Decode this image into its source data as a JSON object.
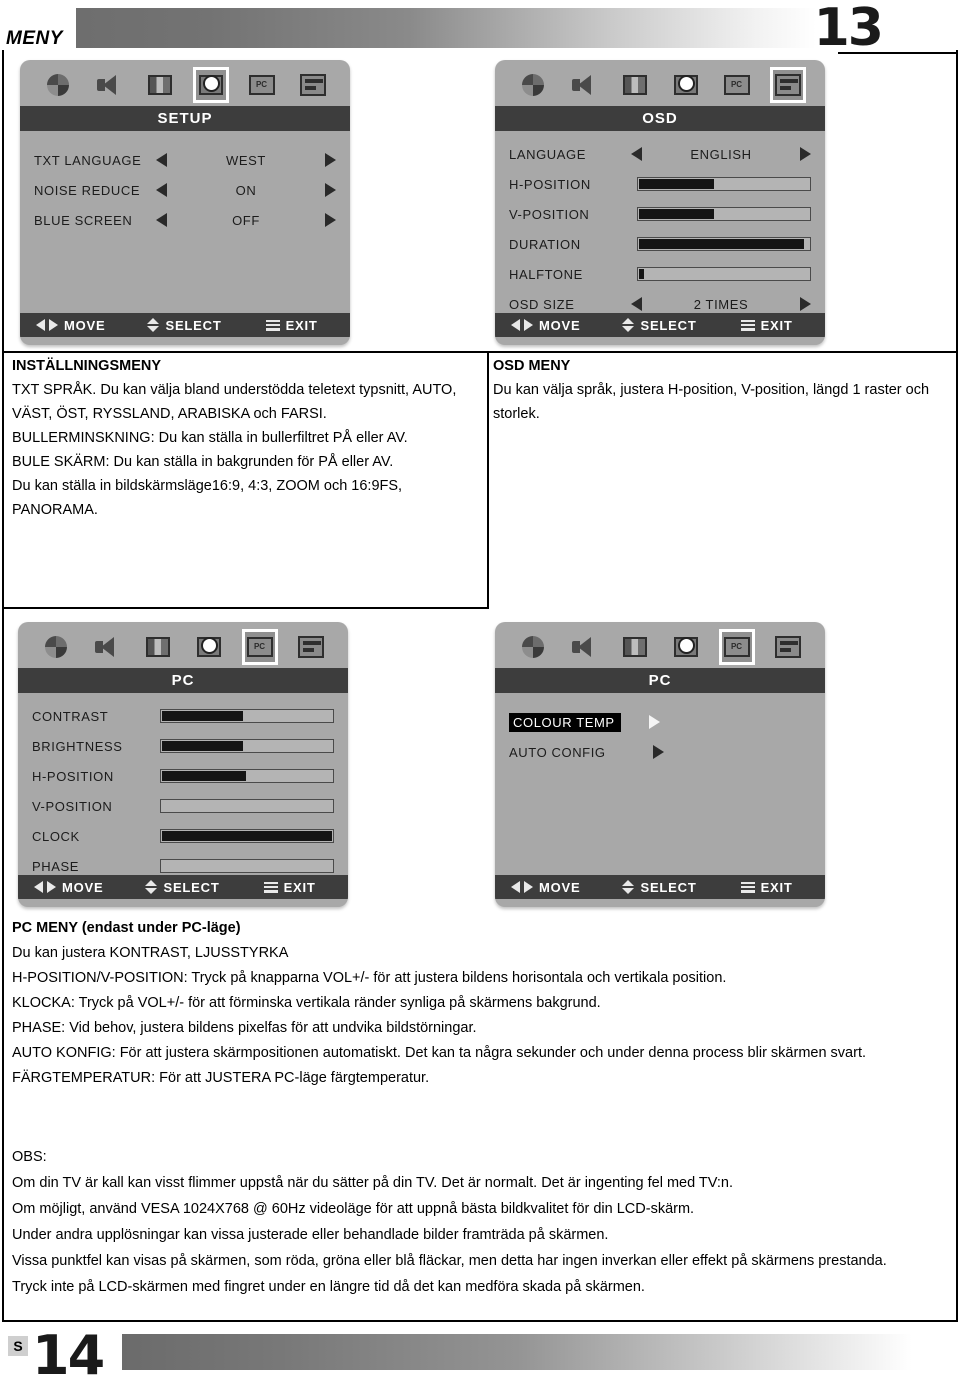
{
  "header": {
    "section_label": "MENY",
    "page_number": "13"
  },
  "footer": {
    "lang_code": "S",
    "page_number": "14"
  },
  "panels": [
    {
      "id": "setup",
      "title": "SETUP",
      "selected_icon_index": 3,
      "icons": [
        "picture-wheel-icon",
        "speaker-icon",
        "tv-screen-icon",
        "clock-setup-icon",
        "pc-icon",
        "osd-settings-icon"
      ],
      "rows": [
        {
          "type": "option",
          "label": "TXT LANGUAGE",
          "value": "WEST"
        },
        {
          "type": "option",
          "label": "NOISE  REDUCE",
          "value": "ON"
        },
        {
          "type": "option",
          "label": "BLUE SCREEN",
          "value": "OFF"
        }
      ],
      "footer": {
        "move": "MOVE",
        "select": "SELECT",
        "exit": "EXIT"
      }
    },
    {
      "id": "osd",
      "title": "OSD",
      "selected_icon_index": 5,
      "icons": [
        "picture-wheel-icon",
        "speaker-icon",
        "tv-screen-icon",
        "clock-setup-icon",
        "pc-icon",
        "osd-settings-icon"
      ],
      "rows": [
        {
          "type": "option",
          "label": "LANGUAGE",
          "value": "ENGLISH"
        },
        {
          "type": "slider",
          "label": "H-POSITION",
          "fill": 45
        },
        {
          "type": "slider",
          "label": "V-POSITION",
          "fill": 45
        },
        {
          "type": "slider",
          "label": "DURATION",
          "fill": 97
        },
        {
          "type": "slider",
          "label": "HALFTONE",
          "fill": 4
        },
        {
          "type": "option",
          "label": "OSD  SIZE",
          "value": "2  TIMES"
        }
      ],
      "footer": {
        "move": "MOVE",
        "select": "SELECT",
        "exit": "EXIT"
      }
    },
    {
      "id": "pc-main",
      "title": "PC",
      "selected_icon_index": 4,
      "icons": [
        "picture-wheel-icon",
        "speaker-icon",
        "tv-screen-icon",
        "clock-setup-icon",
        "pc-icon",
        "osd-settings-icon"
      ],
      "rows": [
        {
          "type": "slider",
          "label": "CONTRAST",
          "fill": 48
        },
        {
          "type": "slider",
          "label": "BRIGHTNESS",
          "fill": 48
        },
        {
          "type": "slider",
          "label": "H-POSITION",
          "fill": 50
        },
        {
          "type": "slider",
          "label": "V-POSITION",
          "fill": 0
        },
        {
          "type": "slider",
          "label": "CLOCK",
          "fill": 100
        },
        {
          "type": "slider",
          "label": "PHASE",
          "fill": 0
        }
      ],
      "footer": {
        "move": "MOVE",
        "select": "SELECT",
        "exit": "EXIT"
      }
    },
    {
      "id": "pc-sub",
      "title": "PC",
      "selected_icon_index": 4,
      "icons": [
        "picture-wheel-icon",
        "speaker-icon",
        "tv-screen-icon",
        "clock-setup-icon",
        "pc-icon",
        "osd-settings-icon"
      ],
      "rows": [
        {
          "type": "submenu",
          "label": "COLOUR TEMP",
          "highlighted": true
        },
        {
          "type": "submenu",
          "label": "AUTO  CONFIG",
          "highlighted": false
        }
      ],
      "footer": {
        "move": "MOVE",
        "select": "SELECT",
        "exit": "EXIT"
      }
    }
  ],
  "text": {
    "setup_menu": {
      "heading": "INSTÄLLNINGSMENY",
      "body": "TXT SPRÅK. Du kan välja bland understödda teletext typsnitt, AUTO, VÄST, ÖST, RYSSLAND, ARABISKA och FARSI.\nBULLERMINSKNING: Du kan ställa in bullerfiltret PÅ eller AV.\nBULE SKÄRM: Du kan ställa in bakgrunden för PÅ eller AV.\nDu kan ställa in bildskärmsläge16:9, 4:3, ZOOM och  16:9FS, PANORAMA."
    },
    "osd_menu": {
      "heading": "OSD MENY",
      "body": "Du kan välja språk, justera H-position, V-position, längd 1 raster och storlek."
    },
    "pc_menu": {
      "heading": "PC MENY (endast under PC-läge)",
      "lines": [
        "Du kan justera KONTRAST, LJUSSTYRKA",
        "H-POSITION/V-POSITION: Tryck på knapparna VOL+/- för att justera bildens horisontala och vertikala position.",
        "KLOCKA: Tryck på VOL+/- för att förminska vertikala ränder synliga på skärmens bakgrund.",
        "PHASE: Vid behov, justera bildens pixelfas för att undvika bildstörningar.",
        "AUTO KONFIG: För att justera skärmpositionen automatiskt. Det kan ta några sekunder och under denna process blir skärmen svart.",
        "FÄRGTEMPERATUR: För att JUSTERA PC-läge färgtemperatur."
      ]
    },
    "note": {
      "heading": "OBS:",
      "lines": [
        "Om din TV är kall kan visst flimmer uppstå när du sätter på din TV. Det är normalt. Det är ingenting fel med TV:n.",
        "Om möjligt, använd VESA 1024X768 @ 60Hz videoläge för att uppnå bästa bildkvalitet för din LCD-skärm.",
        "Under andra upplösningar kan vissa justerade eller behandlade bilder framträda på skärmen.",
        "Vissa punktfel kan visas på skärmen, som röda, gröna eller blå fläckar, men detta har ingen inverkan eller effekt på skärmens prestanda.",
        "Tryck inte på LCD-skärmen med fingret under en längre tid då det kan medföra skada på skärmen."
      ]
    }
  }
}
